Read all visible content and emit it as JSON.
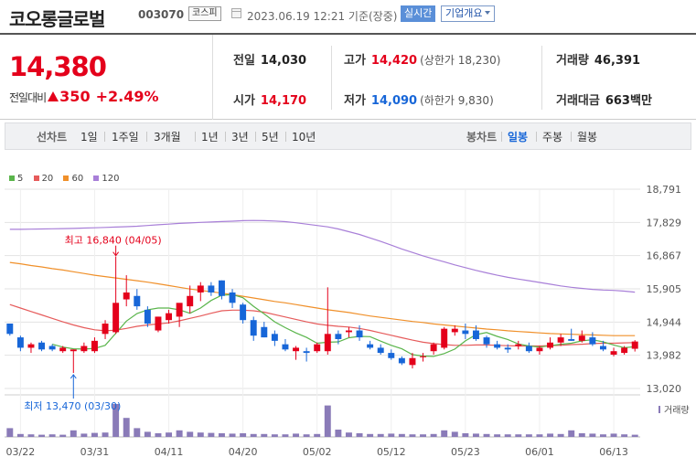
{
  "header": {
    "stock_name": "코오롱글로벌",
    "stock_code": "003070",
    "market": "코스피",
    "datetime": "2023.06.19 12:21  기준(장중)",
    "realtime_label": "실시간",
    "company_label": "기업개요"
  },
  "summary": {
    "price": "14,380",
    "change_label": "전일대비",
    "change_amount": "350",
    "change_percent": "+2.49%",
    "prev_close_label": "전일",
    "prev_close": "14,030",
    "open_label": "시가",
    "open": "14,170",
    "high_label": "고가",
    "high": "14,420",
    "upper_limit": "(상한가 18,230)",
    "low_label": "저가",
    "low": "14,090",
    "lower_limit": "(하한가 9,830)",
    "volume_label": "거래량",
    "volume": "46,391",
    "amount_label": "거래대금",
    "amount": "663",
    "amount_unit": "백만"
  },
  "periods": {
    "line_title": "선차트",
    "line_options": [
      "1일",
      "1주일",
      "3개월",
      "1년",
      "3년",
      "5년",
      "10년"
    ],
    "candle_title": "봉차트",
    "candle_options": [
      "일봉",
      "주봉",
      "월봉"
    ],
    "active_candle": "일봉"
  },
  "colors": {
    "up": "#e4001b",
    "down": "#1766d8",
    "ma5": "#5ab54b",
    "ma20": "#e65b5b",
    "ma60": "#f0902a",
    "ma120": "#a87fd8",
    "volume": "#8a7bb8"
  },
  "chart_data": {
    "type": "candlestick",
    "legend": [
      "5",
      "20",
      "60",
      "120"
    ],
    "y_ticks": [
      "18,791",
      "17,829",
      "16,867",
      "15,905",
      "14,944",
      "13,982",
      "13,020"
    ],
    "y_tick_values": [
      18791,
      17829,
      16867,
      15905,
      14944,
      13982,
      13020
    ],
    "x_ticks": [
      "03/22",
      "03/31",
      "04/11",
      "04/20",
      "05/02",
      "05/12",
      "05/23",
      "06/01",
      "06/13"
    ],
    "x_tick_index": [
      1,
      8,
      15,
      22,
      29,
      36,
      43,
      50,
      57
    ],
    "volume_label": "거래량",
    "high_annotation": "최고 16,840 (04/05)",
    "high_index": 10,
    "high_value": 16840,
    "low_annotation": "최저 13,470 (03/30)",
    "low_index": 6,
    "low_value": 13470,
    "candles": [
      [
        14900,
        14900,
        14550,
        14600
      ],
      [
        14500,
        14550,
        14100,
        14200
      ],
      [
        14200,
        14350,
        14050,
        14300
      ],
      [
        14350,
        14400,
        14100,
        14150
      ],
      [
        14250,
        14300,
        14100,
        14150
      ],
      [
        14100,
        14250,
        14050,
        14200
      ],
      [
        14100,
        14150,
        13470,
        14150
      ],
      [
        14100,
        14350,
        14050,
        14250
      ],
      [
        14100,
        14500,
        14050,
        14400
      ],
      [
        14600,
        15000,
        14450,
        14900
      ],
      [
        14650,
        16840,
        14600,
        15500
      ],
      [
        15600,
        16300,
        15400,
        15800
      ],
      [
        15700,
        15900,
        15300,
        15400
      ],
      [
        15300,
        15400,
        14800,
        14900
      ],
      [
        14700,
        15100,
        14650,
        15100
      ],
      [
        15000,
        15300,
        14900,
        15200
      ],
      [
        15100,
        15400,
        14800,
        15500
      ],
      [
        15400,
        16000,
        15200,
        15700
      ],
      [
        15800,
        16100,
        15550,
        16000
      ],
      [
        16000,
        16100,
        15700,
        15800
      ],
      [
        16150,
        16150,
        15600,
        15700
      ],
      [
        15800,
        15900,
        15350,
        15500
      ],
      [
        15450,
        15500,
        14900,
        15000
      ],
      [
        15000,
        15100,
        14400,
        14550
      ],
      [
        14800,
        14950,
        14500,
        14500
      ],
      [
        14600,
        14700,
        14250,
        14400
      ],
      [
        14300,
        14450,
        14100,
        14150
      ],
      [
        14100,
        14250,
        13850,
        14200
      ],
      [
        14100,
        14200,
        13800,
        14050
      ],
      [
        14100,
        14350,
        14050,
        14300
      ],
      [
        14100,
        15950,
        14000,
        14600
      ],
      [
        14600,
        14700,
        14300,
        14450
      ],
      [
        14650,
        14800,
        14500,
        14700
      ],
      [
        14700,
        14850,
        14400,
        14500
      ],
      [
        14300,
        14400,
        14150,
        14200
      ],
      [
        14200,
        14300,
        14000,
        14050
      ],
      [
        14050,
        14150,
        13850,
        13900
      ],
      [
        13900,
        13950,
        13700,
        13750
      ],
      [
        13700,
        14050,
        13600,
        13900
      ],
      [
        13950,
        14050,
        13800,
        13950
      ],
      [
        14100,
        14350,
        14000,
        14300
      ],
      [
        14200,
        14800,
        14150,
        14750
      ],
      [
        14650,
        14850,
        14550,
        14750
      ],
      [
        14700,
        14900,
        14450,
        14600
      ],
      [
        14700,
        14850,
        14400,
        14450
      ],
      [
        14500,
        14550,
        14200,
        14300
      ],
      [
        14300,
        14400,
        14150,
        14200
      ],
      [
        14200,
        14300,
        14050,
        14150
      ],
      [
        14250,
        14400,
        14150,
        14300
      ],
      [
        14250,
        14350,
        14050,
        14100
      ],
      [
        14100,
        14250,
        14000,
        14200
      ],
      [
        14200,
        14500,
        14150,
        14350
      ],
      [
        14350,
        14600,
        14250,
        14500
      ],
      [
        14450,
        14750,
        14400,
        14400
      ],
      [
        14400,
        14700,
        14350,
        14550
      ],
      [
        14500,
        14650,
        14250,
        14300
      ],
      [
        14250,
        14400,
        14100,
        14150
      ],
      [
        14000,
        14200,
        13950,
        14100
      ],
      [
        14050,
        14250,
        14000,
        14200
      ],
      [
        14170,
        14420,
        14090,
        14380
      ]
    ],
    "volumes": [
      1.2,
      0.4,
      0.35,
      0.3,
      0.35,
      0.3,
      0.9,
      0.45,
      0.55,
      0.6,
      4.5,
      2.6,
      1.2,
      0.7,
      0.5,
      0.6,
      0.9,
      0.7,
      0.6,
      0.55,
      0.5,
      0.45,
      0.5,
      0.4,
      0.4,
      0.35,
      0.35,
      0.45,
      0.35,
      0.4,
      4.3,
      1.0,
      0.6,
      0.5,
      0.4,
      0.4,
      0.45,
      0.4,
      0.35,
      0.35,
      0.4,
      0.9,
      0.7,
      0.5,
      0.45,
      0.4,
      0.35,
      0.35,
      0.35,
      0.35,
      0.35,
      0.45,
      0.4,
      0.9,
      0.5,
      0.45,
      0.35,
      0.45,
      0.35,
      0.3
    ],
    "ma120": [
      17630,
      17630,
      17635,
      17640,
      17645,
      17650,
      17655,
      17665,
      17675,
      17685,
      17695,
      17705,
      17720,
      17740,
      17760,
      17780,
      17800,
      17815,
      17830,
      17840,
      17855,
      17865,
      17880,
      17885,
      17880,
      17870,
      17850,
      17820,
      17780,
      17740,
      17700,
      17640,
      17560,
      17480,
      17380,
      17280,
      17170,
      17060,
      16960,
      16860,
      16770,
      16690,
      16600,
      16520,
      16440,
      16370,
      16300,
      16240,
      16190,
      16140,
      16090,
      16040,
      15990,
      15950,
      15920,
      15890,
      15870,
      15860,
      15840,
      15810
    ],
    "ma60": [
      16670,
      16630,
      16580,
      16540,
      16490,
      16450,
      16400,
      16350,
      16300,
      16260,
      16220,
      16180,
      16140,
      16100,
      16050,
      16000,
      15950,
      15900,
      15860,
      15820,
      15780,
      15740,
      15690,
      15640,
      15590,
      15540,
      15500,
      15450,
      15400,
      15350,
      15300,
      15260,
      15220,
      15170,
      15120,
      15080,
      15040,
      15000,
      14960,
      14930,
      14890,
      14860,
      14830,
      14800,
      14770,
      14740,
      14720,
      14690,
      14670,
      14650,
      14630,
      14610,
      14600,
      14590,
      14580,
      14570,
      14560,
      14550,
      14550,
      14550
    ],
    "ma20": [
      15450,
      15350,
      15250,
      15150,
      15050,
      14950,
      14860,
      14780,
      14720,
      14690,
      14710,
      14760,
      14820,
      14860,
      14890,
      14920,
      14980,
      15050,
      15120,
      15200,
      15270,
      15290,
      15290,
      15270,
      15230,
      15160,
      15090,
      15020,
      14950,
      14890,
      14850,
      14820,
      14800,
      14760,
      14700,
      14630,
      14560,
      14490,
      14420,
      14360,
      14320,
      14290,
      14270,
      14270,
      14280,
      14280,
      14270,
      14260,
      14250,
      14250,
      14250,
      14260,
      14270,
      14290,
      14300,
      14320,
      14330,
      14330,
      14340,
      14350
    ],
    "ma5": [
      null,
      null,
      null,
      null,
      14300,
      14220,
      14170,
      14160,
      14180,
      14270,
      14620,
      14970,
      15190,
      15300,
      15350,
      15350,
      15300,
      15200,
      15350,
      15570,
      15720,
      15740,
      15650,
      15400,
      15180,
      14950,
      14780,
      14630,
      14500,
      14330,
      14360,
      14370,
      14490,
      14530,
      14520,
      14390,
      14270,
      14170,
      14000,
      13960,
      13950,
      14030,
      14160,
      14400,
      14580,
      14640,
      14530,
      14440,
      14310,
      14250,
      14220,
      14260,
      14300,
      14330,
      14400,
      14430,
      14370,
      14280,
      14200,
      14230
    ]
  }
}
